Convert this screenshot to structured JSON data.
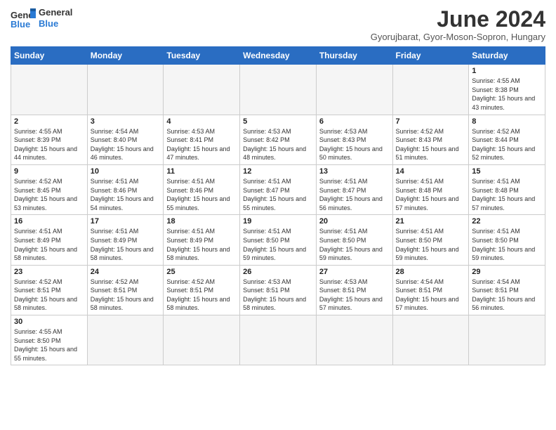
{
  "header": {
    "logo_general": "General",
    "logo_blue": "Blue",
    "month_title": "June 2024",
    "subtitle": "Gyorujbarat, Gyor-Moson-Sopron, Hungary"
  },
  "weekdays": [
    "Sunday",
    "Monday",
    "Tuesday",
    "Wednesday",
    "Thursday",
    "Friday",
    "Saturday"
  ],
  "weeks": [
    [
      {
        "day": "",
        "info": ""
      },
      {
        "day": "",
        "info": ""
      },
      {
        "day": "",
        "info": ""
      },
      {
        "day": "",
        "info": ""
      },
      {
        "day": "",
        "info": ""
      },
      {
        "day": "",
        "info": ""
      },
      {
        "day": "1",
        "info": "Sunrise: 4:55 AM\nSunset: 8:38 PM\nDaylight: 15 hours and 43 minutes."
      }
    ],
    [
      {
        "day": "2",
        "info": "Sunrise: 4:55 AM\nSunset: 8:39 PM\nDaylight: 15 hours and 44 minutes."
      },
      {
        "day": "3",
        "info": "Sunrise: 4:54 AM\nSunset: 8:40 PM\nDaylight: 15 hours and 46 minutes."
      },
      {
        "day": "4",
        "info": "Sunrise: 4:53 AM\nSunset: 8:41 PM\nDaylight: 15 hours and 47 minutes."
      },
      {
        "day": "5",
        "info": "Sunrise: 4:53 AM\nSunset: 8:42 PM\nDaylight: 15 hours and 48 minutes."
      },
      {
        "day": "6",
        "info": "Sunrise: 4:53 AM\nSunset: 8:43 PM\nDaylight: 15 hours and 50 minutes."
      },
      {
        "day": "7",
        "info": "Sunrise: 4:52 AM\nSunset: 8:43 PM\nDaylight: 15 hours and 51 minutes."
      },
      {
        "day": "8",
        "info": "Sunrise: 4:52 AM\nSunset: 8:44 PM\nDaylight: 15 hours and 52 minutes."
      }
    ],
    [
      {
        "day": "9",
        "info": "Sunrise: 4:52 AM\nSunset: 8:45 PM\nDaylight: 15 hours and 53 minutes."
      },
      {
        "day": "10",
        "info": "Sunrise: 4:51 AM\nSunset: 8:46 PM\nDaylight: 15 hours and 54 minutes."
      },
      {
        "day": "11",
        "info": "Sunrise: 4:51 AM\nSunset: 8:46 PM\nDaylight: 15 hours and 55 minutes."
      },
      {
        "day": "12",
        "info": "Sunrise: 4:51 AM\nSunset: 8:47 PM\nDaylight: 15 hours and 55 minutes."
      },
      {
        "day": "13",
        "info": "Sunrise: 4:51 AM\nSunset: 8:47 PM\nDaylight: 15 hours and 56 minutes."
      },
      {
        "day": "14",
        "info": "Sunrise: 4:51 AM\nSunset: 8:48 PM\nDaylight: 15 hours and 57 minutes."
      },
      {
        "day": "15",
        "info": "Sunrise: 4:51 AM\nSunset: 8:48 PM\nDaylight: 15 hours and 57 minutes."
      }
    ],
    [
      {
        "day": "16",
        "info": "Sunrise: 4:51 AM\nSunset: 8:49 PM\nDaylight: 15 hours and 58 minutes."
      },
      {
        "day": "17",
        "info": "Sunrise: 4:51 AM\nSunset: 8:49 PM\nDaylight: 15 hours and 58 minutes."
      },
      {
        "day": "18",
        "info": "Sunrise: 4:51 AM\nSunset: 8:49 PM\nDaylight: 15 hours and 58 minutes."
      },
      {
        "day": "19",
        "info": "Sunrise: 4:51 AM\nSunset: 8:50 PM\nDaylight: 15 hours and 59 minutes."
      },
      {
        "day": "20",
        "info": "Sunrise: 4:51 AM\nSunset: 8:50 PM\nDaylight: 15 hours and 59 minutes."
      },
      {
        "day": "21",
        "info": "Sunrise: 4:51 AM\nSunset: 8:50 PM\nDaylight: 15 hours and 59 minutes."
      },
      {
        "day": "22",
        "info": "Sunrise: 4:51 AM\nSunset: 8:50 PM\nDaylight: 15 hours and 59 minutes."
      }
    ],
    [
      {
        "day": "23",
        "info": "Sunrise: 4:52 AM\nSunset: 8:51 PM\nDaylight: 15 hours and 58 minutes."
      },
      {
        "day": "24",
        "info": "Sunrise: 4:52 AM\nSunset: 8:51 PM\nDaylight: 15 hours and 58 minutes."
      },
      {
        "day": "25",
        "info": "Sunrise: 4:52 AM\nSunset: 8:51 PM\nDaylight: 15 hours and 58 minutes."
      },
      {
        "day": "26",
        "info": "Sunrise: 4:53 AM\nSunset: 8:51 PM\nDaylight: 15 hours and 58 minutes."
      },
      {
        "day": "27",
        "info": "Sunrise: 4:53 AM\nSunset: 8:51 PM\nDaylight: 15 hours and 57 minutes."
      },
      {
        "day": "28",
        "info": "Sunrise: 4:54 AM\nSunset: 8:51 PM\nDaylight: 15 hours and 57 minutes."
      },
      {
        "day": "29",
        "info": "Sunrise: 4:54 AM\nSunset: 8:51 PM\nDaylight: 15 hours and 56 minutes."
      }
    ],
    [
      {
        "day": "30",
        "info": "Sunrise: 4:55 AM\nSunset: 8:50 PM\nDaylight: 15 hours and 55 minutes."
      },
      {
        "day": "",
        "info": ""
      },
      {
        "day": "",
        "info": ""
      },
      {
        "day": "",
        "info": ""
      },
      {
        "day": "",
        "info": ""
      },
      {
        "day": "",
        "info": ""
      },
      {
        "day": "",
        "info": ""
      }
    ]
  ]
}
